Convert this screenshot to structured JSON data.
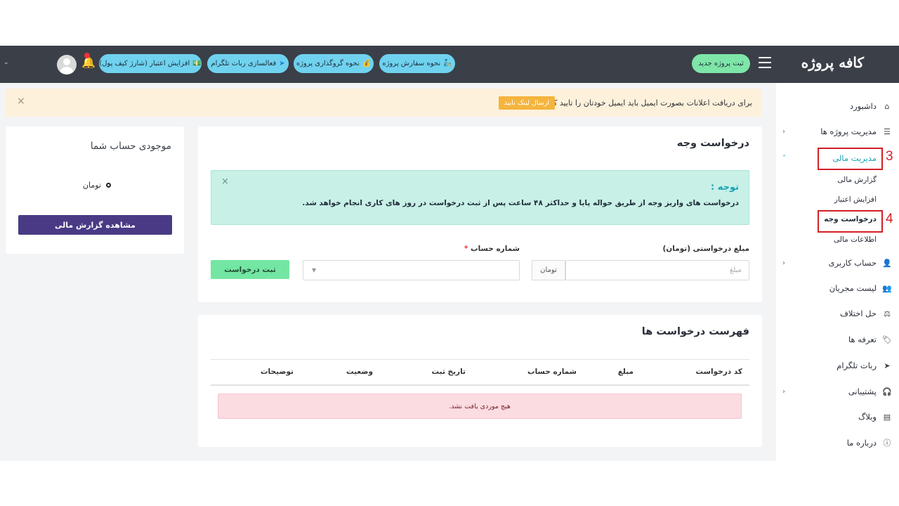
{
  "header": {
    "logo": "کافه پروژه",
    "new_project": "ثبت پروژه جدید",
    "pills": [
      {
        "label": "نحوه سفارش پروژه",
        "icon": "🧞"
      },
      {
        "label": "نحوه گروگذاری پروژه",
        "icon": "💰"
      },
      {
        "label": "فعالسازی ربات تلگرام",
        "icon": "➤"
      },
      {
        "label": "افزایش اعتبار (شارژ کیف پول)",
        "icon": "💵"
      }
    ],
    "bell_icon": "bell-icon",
    "caret": "⌄"
  },
  "sidebar": {
    "items": [
      {
        "label": "داشبورد",
        "icon": "⌂"
      },
      {
        "label": "مدیریت پروژه ها",
        "icon": "☰",
        "chevron": "‹"
      },
      {
        "label": "مدیریت مالی",
        "icon": "",
        "chevron": "˄"
      },
      {
        "label": "حساب کاربری",
        "icon": "👤",
        "chevron": "‹"
      },
      {
        "label": "لیست مجریان",
        "icon": "👥"
      },
      {
        "label": "حل اختلاف",
        "icon": "⚖"
      },
      {
        "label": "تعرفه ها",
        "icon": "🏷"
      },
      {
        "label": "ربات تلگرام",
        "icon": "➤"
      },
      {
        "label": "پشتیبانی",
        "icon": "🎧",
        "chevron": "‹"
      },
      {
        "label": "وبلاگ",
        "icon": "▤"
      },
      {
        "label": "درباره ما",
        "icon": "ⓘ"
      }
    ],
    "sub_items": [
      "گزارش مالی",
      "افزایش اعتبار",
      "درخواست وجه",
      "اطلاعات مالی"
    ],
    "annotations": {
      "step3": "3",
      "step4": "4"
    }
  },
  "alert": {
    "text": "برای دریافت اعلانات بصورت ایمیل باید ایمیل خودتان را تایید کنید.",
    "button": "ارسال لینک تایید",
    "close": "×"
  },
  "balance": {
    "title": "موجودی حساب شما",
    "value": "تومان",
    "button": "مشاهده گزارش مالی"
  },
  "request": {
    "title": "درخواست وجه",
    "note_title": "توجه :",
    "note_text": "درخواست های واریز وجه از طریق حواله پایا و حداکثر ۴۸ ساعت پس از ثبت درخواست در روز های کاری انجام خواهد شد.",
    "note_close": "×",
    "amount_label": "مبلغ درخواستی (تومان)",
    "amount_placeholder": "مبلغ",
    "amount_addon": "تومان",
    "account_label": "شماره حساب",
    "required_mark": "*",
    "select_arrow": "▼",
    "submit": "ثبت درخواست"
  },
  "list": {
    "title": "فهرست درخواست ها",
    "columns": [
      "کد درخواست",
      "مبلغ",
      "شماره حساب",
      "تاریخ ثبت",
      "وضعیت",
      "توضیحات"
    ],
    "empty": "هیچ موردی یافت نشد."
  },
  "colors": {
    "topbar": "#3a3f48",
    "accent": "#1aa3b5",
    "highlight": "#d31f26",
    "purple": "#4a3a85"
  }
}
